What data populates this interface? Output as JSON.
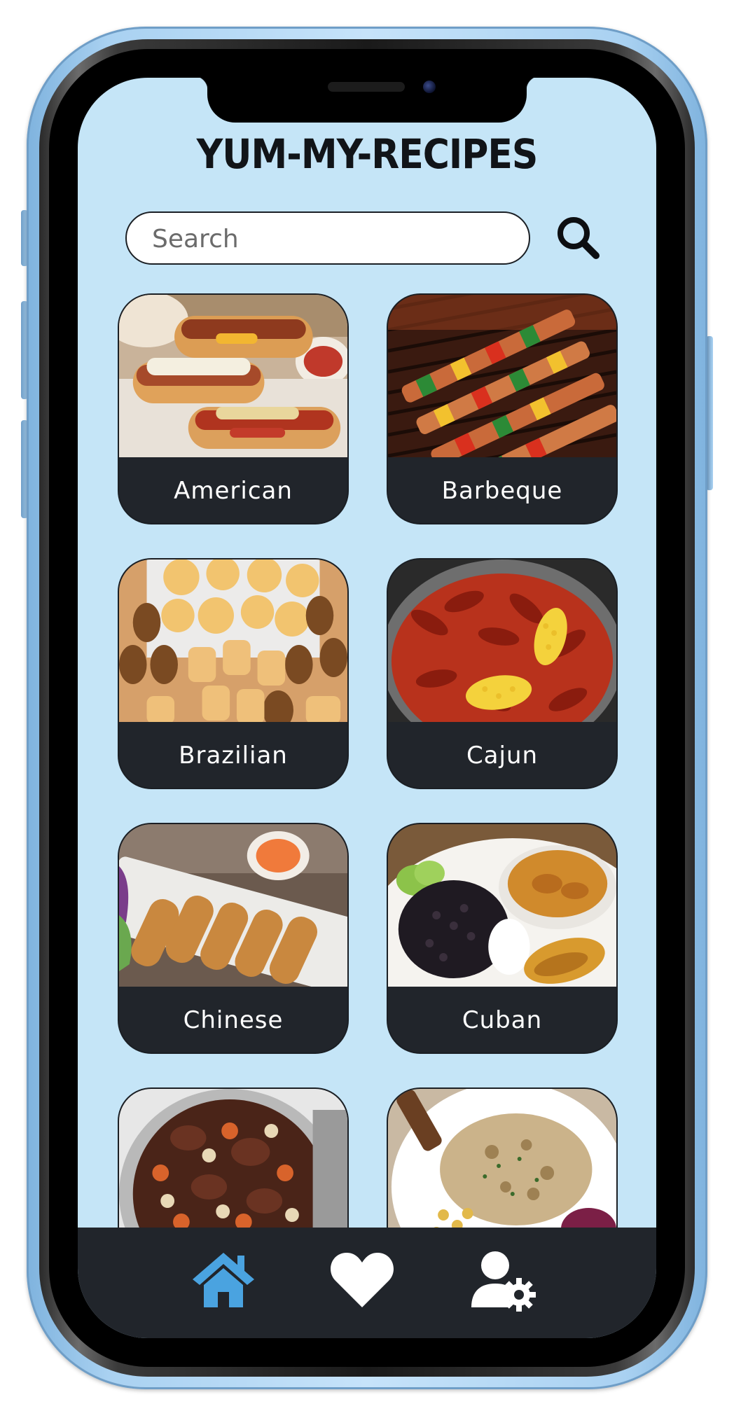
{
  "app": {
    "title": "YUM-MY-RECIPES"
  },
  "search": {
    "placeholder": "Search",
    "value": "",
    "icon": "search-icon"
  },
  "categories": [
    {
      "label": "American",
      "image": "hot-dogs-photo"
    },
    {
      "label": "Barbeque",
      "image": "grilled-kebabs-photo"
    },
    {
      "label": "Brazilian",
      "image": "coxinha-pastries-photo"
    },
    {
      "label": "Cajun",
      "image": "crawfish-boil-photo"
    },
    {
      "label": "Chinese",
      "image": "egg-rolls-photo"
    },
    {
      "label": "Cuban",
      "image": "black-beans-plate-photo"
    },
    {
      "label": "",
      "image": "beef-stew-photo"
    },
    {
      "label": "",
      "image": "chicken-cream-sauce-photo"
    }
  ],
  "bottom_nav": {
    "items": [
      {
        "name": "home",
        "icon": "home-icon",
        "active": true
      },
      {
        "name": "favorites",
        "icon": "heart-icon",
        "active": false
      },
      {
        "name": "profile-settings",
        "icon": "user-settings-icon",
        "active": false
      }
    ]
  },
  "colors": {
    "screen_background": "#c5e5f7",
    "card_background": "#21252b",
    "nav_background": "#21252b",
    "active_icon": "#4aa3e0",
    "inactive_icon": "#ffffff",
    "phone_frame": "#a9d1f1"
  }
}
